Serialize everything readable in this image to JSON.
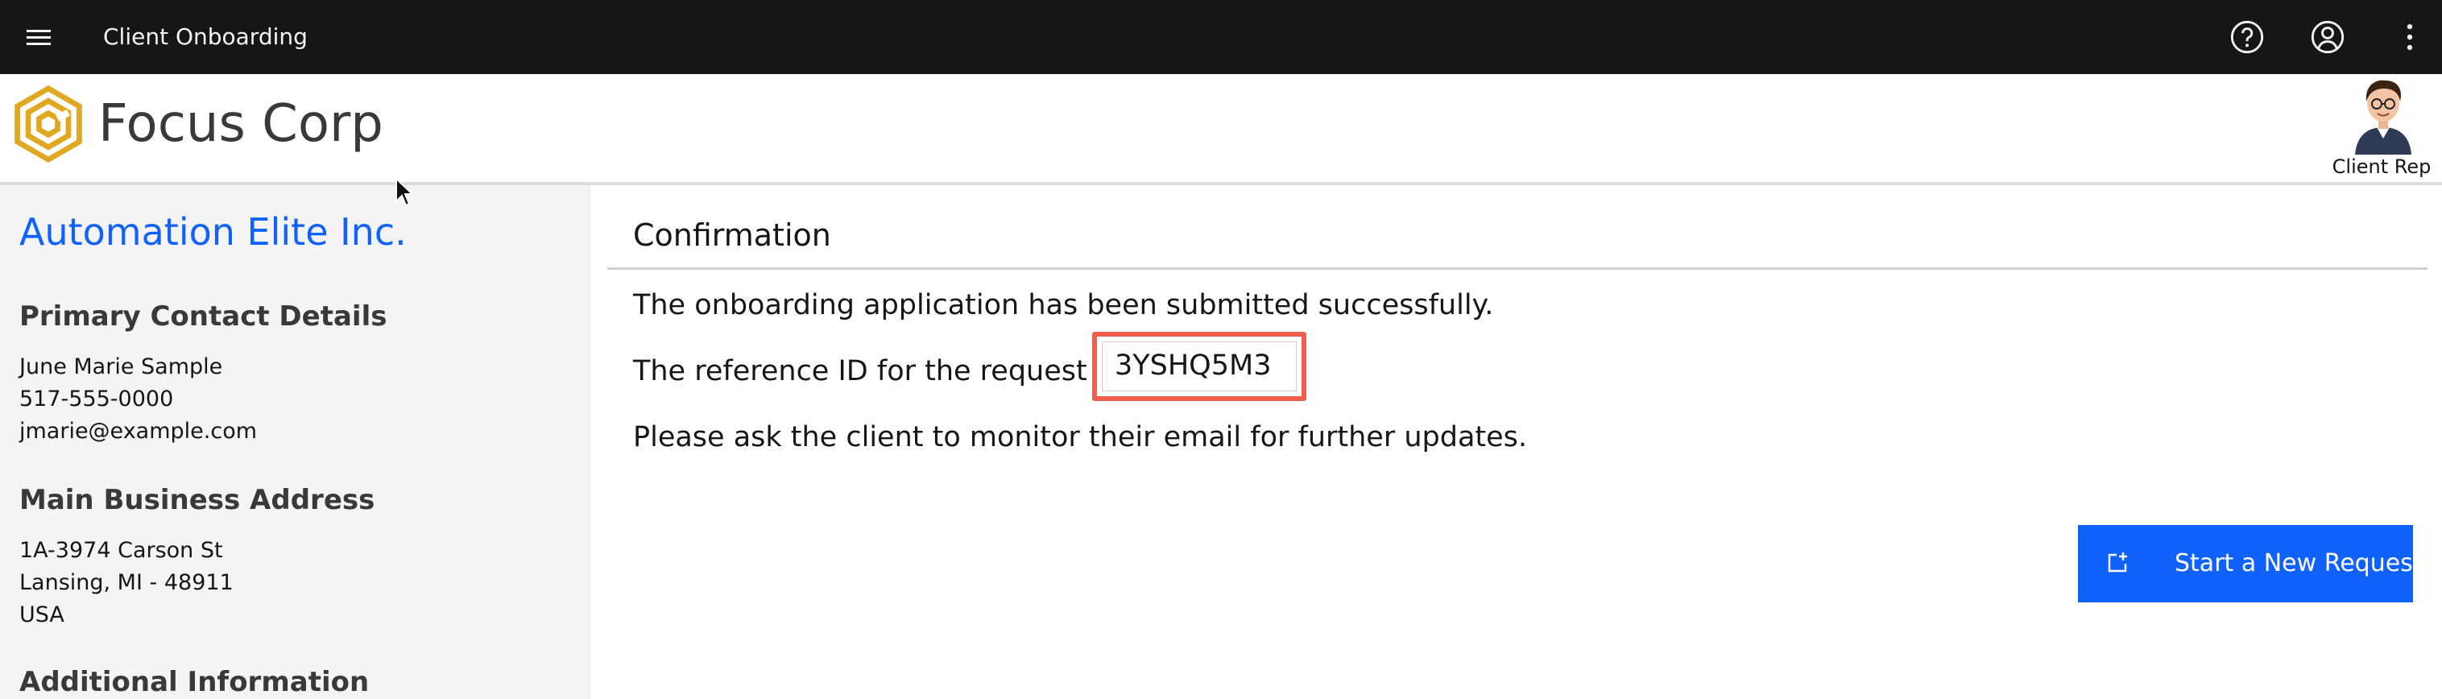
{
  "header": {
    "menu_icon": "hamburger-menu-icon",
    "app_title": "Client Onboarding",
    "icons": [
      "help-icon",
      "user-profile-icon",
      "overflow-menu-icon"
    ]
  },
  "brand": {
    "logo_icon": "hexagon-logo-icon",
    "company_name": "Focus Corp",
    "rep_label": "Client Rep"
  },
  "sidebar": {
    "client_name": "Automation Elite Inc.",
    "contact": {
      "heading": "Primary Contact Details",
      "name": "June Marie Sample",
      "phone": "517-555-0000",
      "email": "jmarie@example.com"
    },
    "address": {
      "heading": "Main Business Address",
      "line1": "1A-3974 Carson St",
      "line2": "Lansing, MI - 48911",
      "line3": "USA"
    },
    "additional": {
      "heading": "Additional Information"
    }
  },
  "main": {
    "title": "Confirmation",
    "success_message": "The onboarding application has been submitted successfully.",
    "reference_label": "The reference ID for the request is:",
    "reference_id": "3YSHQ5M3",
    "followup_message": "Please ask the client to monitor their email for further updates.",
    "new_request_button": "Start a New Request"
  },
  "colors": {
    "topbar_bg": "#161616",
    "accent": "#0f62fe",
    "highlight_border": "#ef5d4e",
    "logo_gold": "#e0a820"
  }
}
